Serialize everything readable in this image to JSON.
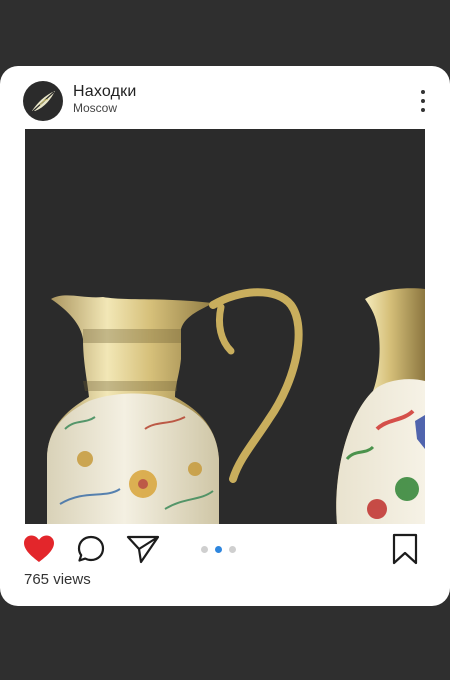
{
  "post": {
    "username": "Находки",
    "location": "Moscow",
    "views": "765 views",
    "liked": true,
    "carousel": {
      "total": 3,
      "active_index": 1
    }
  },
  "colors": {
    "background": "#2f2f2f",
    "card": "#ffffff",
    "like": "#e3262b",
    "active_dot": "#2e86de",
    "inactive_dot": "#cfcfcf"
  },
  "icons": {
    "avatar": "leaf-logo",
    "more": "more-vertical-icon",
    "like": "heart-icon",
    "comment": "comment-icon",
    "share": "send-icon",
    "save": "bookmark-icon"
  }
}
